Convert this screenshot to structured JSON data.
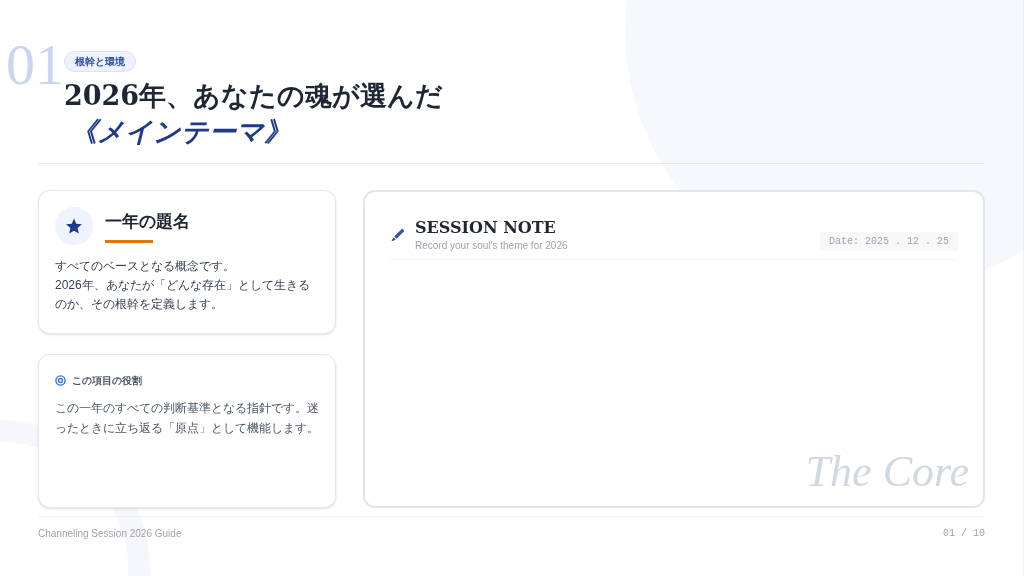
{
  "header": {
    "number": "01",
    "badge": "根幹と環境",
    "title_line1": "2026年、あなたの魂が選んだ",
    "title_line2": "《メインテーマ》"
  },
  "title_card": {
    "heading": "一年の題名",
    "body_lines": [
      "すべてのベースとなる概念です。",
      "2026年、あなたが「どんな存在」として生きるのか、その根幹を定義します。"
    ]
  },
  "role_card": {
    "heading": "この項目の役割",
    "body": "この一年のすべての判断基準となる指針です。迷ったときに立ち返る「原点」として機能します。"
  },
  "note": {
    "title": "SESSION NOTE",
    "subtitle": "Record your soul's theme for 2026",
    "date": "Date: 2025 . 12 . 25",
    "watermark_text": "The Core"
  },
  "footer": {
    "guide": "Channeling Session 2026 Guide",
    "page": "01 / 10"
  }
}
